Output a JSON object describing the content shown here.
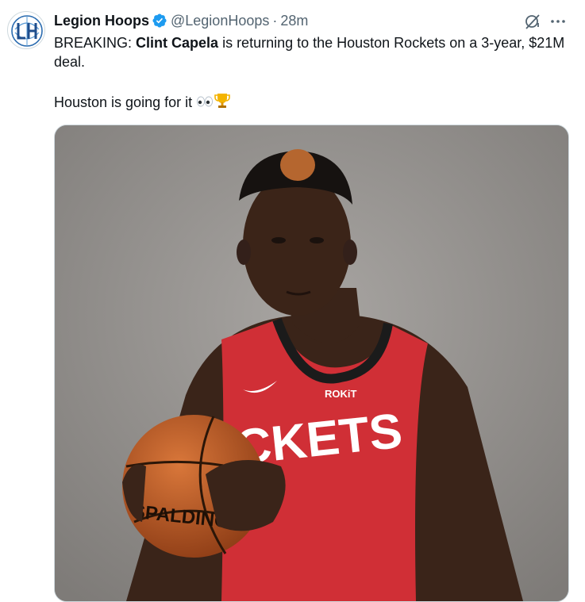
{
  "author": {
    "display_name": "Legion Hoops",
    "handle": "@LegionHoops",
    "time": "28m",
    "avatar_icon": "legion-hoops-logo",
    "verified_icon": "verified-badge-icon"
  },
  "tweet": {
    "line1_prefix": "BREAKING: ",
    "line1_bold": "Clint Capela",
    "line1_suffix": " is returning to the Houston Rockets on a 3-year, $21M deal.",
    "line2_text": "Houston is going for it",
    "line2_emojis": [
      "eyes-emoji",
      "trophy-emoji"
    ]
  },
  "media": {
    "jersey_sponsor": "ROKiT",
    "jersey_text": "CKETS",
    "ball_brand": "SPALDING"
  },
  "colors": {
    "text_primary": "#0f1419",
    "text_secondary": "#536471",
    "verified_blue": "#1d9bf0",
    "jersey_red": "#d02f36"
  },
  "icons": {
    "grok": "grok-icon",
    "more": "more-options-icon"
  }
}
